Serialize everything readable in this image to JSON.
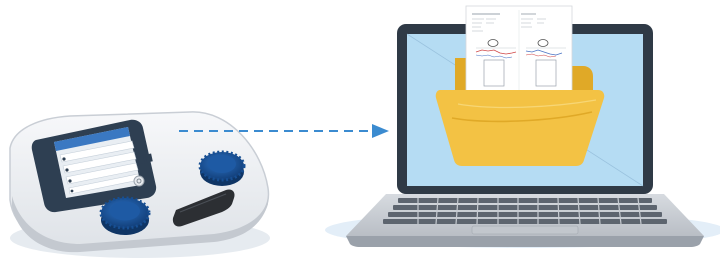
{
  "illustration": {
    "device": {
      "screen_rows": 4,
      "knob_color": "#1f5ea8",
      "screen_bezel_color": "#2e3f52",
      "screen_header_color": "#3a78c2"
    },
    "transfer_arrow": {
      "style": "dashed",
      "color": "#3b8bd0",
      "direction": "device-to-laptop"
    },
    "laptop": {
      "screen_color": "#b5dcf3",
      "bezel_color": "#2f3a46",
      "body_color": "#cfd3d8"
    },
    "folder": {
      "color": "#f3c244",
      "shade_color": "#e0a927"
    },
    "report_page": {
      "sections": [
        "left-ear",
        "right-ear"
      ]
    },
    "icons": [
      "audiometer-device",
      "arrow-right-icon",
      "laptop",
      "folder-icon",
      "document-icon"
    ]
  }
}
